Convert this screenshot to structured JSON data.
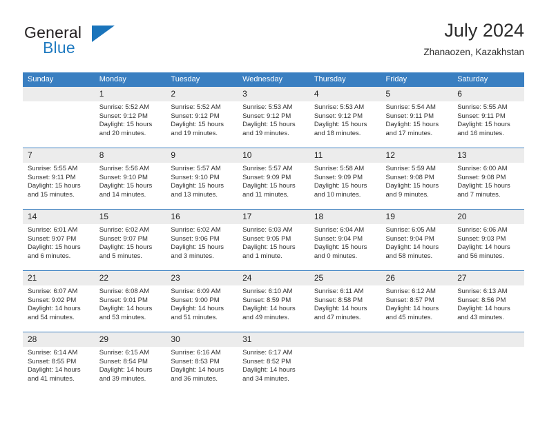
{
  "brand": {
    "name_part1": "General",
    "name_part2": "Blue",
    "triangle_icon": "triangle-icon",
    "accent_color": "#1a74bb"
  },
  "header": {
    "title": "July 2024",
    "location": "Zhanaozen, Kazakhstan"
  },
  "theme": {
    "header_blue": "#3a7fc1",
    "daynum_gray": "#ececec",
    "text": "#303030"
  },
  "calendar": {
    "columns": [
      "Sunday",
      "Monday",
      "Tuesday",
      "Wednesday",
      "Thursday",
      "Friday",
      "Saturday"
    ],
    "weeks": [
      [
        {
          "day": "",
          "empty": true
        },
        {
          "day": "1",
          "sunrise": "Sunrise: 5:52 AM",
          "sunset": "Sunset: 9:12 PM",
          "daylight1": "Daylight: 15 hours",
          "daylight2": "and 20 minutes."
        },
        {
          "day": "2",
          "sunrise": "Sunrise: 5:52 AM",
          "sunset": "Sunset: 9:12 PM",
          "daylight1": "Daylight: 15 hours",
          "daylight2": "and 19 minutes."
        },
        {
          "day": "3",
          "sunrise": "Sunrise: 5:53 AM",
          "sunset": "Sunset: 9:12 PM",
          "daylight1": "Daylight: 15 hours",
          "daylight2": "and 19 minutes."
        },
        {
          "day": "4",
          "sunrise": "Sunrise: 5:53 AM",
          "sunset": "Sunset: 9:12 PM",
          "daylight1": "Daylight: 15 hours",
          "daylight2": "and 18 minutes."
        },
        {
          "day": "5",
          "sunrise": "Sunrise: 5:54 AM",
          "sunset": "Sunset: 9:11 PM",
          "daylight1": "Daylight: 15 hours",
          "daylight2": "and 17 minutes."
        },
        {
          "day": "6",
          "sunrise": "Sunrise: 5:55 AM",
          "sunset": "Sunset: 9:11 PM",
          "daylight1": "Daylight: 15 hours",
          "daylight2": "and 16 minutes."
        }
      ],
      [
        {
          "day": "7",
          "sunrise": "Sunrise: 5:55 AM",
          "sunset": "Sunset: 9:11 PM",
          "daylight1": "Daylight: 15 hours",
          "daylight2": "and 15 minutes."
        },
        {
          "day": "8",
          "sunrise": "Sunrise: 5:56 AM",
          "sunset": "Sunset: 9:10 PM",
          "daylight1": "Daylight: 15 hours",
          "daylight2": "and 14 minutes."
        },
        {
          "day": "9",
          "sunrise": "Sunrise: 5:57 AM",
          "sunset": "Sunset: 9:10 PM",
          "daylight1": "Daylight: 15 hours",
          "daylight2": "and 13 minutes."
        },
        {
          "day": "10",
          "sunrise": "Sunrise: 5:57 AM",
          "sunset": "Sunset: 9:09 PM",
          "daylight1": "Daylight: 15 hours",
          "daylight2": "and 11 minutes."
        },
        {
          "day": "11",
          "sunrise": "Sunrise: 5:58 AM",
          "sunset": "Sunset: 9:09 PM",
          "daylight1": "Daylight: 15 hours",
          "daylight2": "and 10 minutes."
        },
        {
          "day": "12",
          "sunrise": "Sunrise: 5:59 AM",
          "sunset": "Sunset: 9:08 PM",
          "daylight1": "Daylight: 15 hours",
          "daylight2": "and 9 minutes."
        },
        {
          "day": "13",
          "sunrise": "Sunrise: 6:00 AM",
          "sunset": "Sunset: 9:08 PM",
          "daylight1": "Daylight: 15 hours",
          "daylight2": "and 7 minutes."
        }
      ],
      [
        {
          "day": "14",
          "sunrise": "Sunrise: 6:01 AM",
          "sunset": "Sunset: 9:07 PM",
          "daylight1": "Daylight: 15 hours",
          "daylight2": "and 6 minutes."
        },
        {
          "day": "15",
          "sunrise": "Sunrise: 6:02 AM",
          "sunset": "Sunset: 9:07 PM",
          "daylight1": "Daylight: 15 hours",
          "daylight2": "and 5 minutes."
        },
        {
          "day": "16",
          "sunrise": "Sunrise: 6:02 AM",
          "sunset": "Sunset: 9:06 PM",
          "daylight1": "Daylight: 15 hours",
          "daylight2": "and 3 minutes."
        },
        {
          "day": "17",
          "sunrise": "Sunrise: 6:03 AM",
          "sunset": "Sunset: 9:05 PM",
          "daylight1": "Daylight: 15 hours",
          "daylight2": "and 1 minute."
        },
        {
          "day": "18",
          "sunrise": "Sunrise: 6:04 AM",
          "sunset": "Sunset: 9:04 PM",
          "daylight1": "Daylight: 15 hours",
          "daylight2": "and 0 minutes."
        },
        {
          "day": "19",
          "sunrise": "Sunrise: 6:05 AM",
          "sunset": "Sunset: 9:04 PM",
          "daylight1": "Daylight: 14 hours",
          "daylight2": "and 58 minutes."
        },
        {
          "day": "20",
          "sunrise": "Sunrise: 6:06 AM",
          "sunset": "Sunset: 9:03 PM",
          "daylight1": "Daylight: 14 hours",
          "daylight2": "and 56 minutes."
        }
      ],
      [
        {
          "day": "21",
          "sunrise": "Sunrise: 6:07 AM",
          "sunset": "Sunset: 9:02 PM",
          "daylight1": "Daylight: 14 hours",
          "daylight2": "and 54 minutes."
        },
        {
          "day": "22",
          "sunrise": "Sunrise: 6:08 AM",
          "sunset": "Sunset: 9:01 PM",
          "daylight1": "Daylight: 14 hours",
          "daylight2": "and 53 minutes."
        },
        {
          "day": "23",
          "sunrise": "Sunrise: 6:09 AM",
          "sunset": "Sunset: 9:00 PM",
          "daylight1": "Daylight: 14 hours",
          "daylight2": "and 51 minutes."
        },
        {
          "day": "24",
          "sunrise": "Sunrise: 6:10 AM",
          "sunset": "Sunset: 8:59 PM",
          "daylight1": "Daylight: 14 hours",
          "daylight2": "and 49 minutes."
        },
        {
          "day": "25",
          "sunrise": "Sunrise: 6:11 AM",
          "sunset": "Sunset: 8:58 PM",
          "daylight1": "Daylight: 14 hours",
          "daylight2": "and 47 minutes."
        },
        {
          "day": "26",
          "sunrise": "Sunrise: 6:12 AM",
          "sunset": "Sunset: 8:57 PM",
          "daylight1": "Daylight: 14 hours",
          "daylight2": "and 45 minutes."
        },
        {
          "day": "27",
          "sunrise": "Sunrise: 6:13 AM",
          "sunset": "Sunset: 8:56 PM",
          "daylight1": "Daylight: 14 hours",
          "daylight2": "and 43 minutes."
        }
      ],
      [
        {
          "day": "28",
          "sunrise": "Sunrise: 6:14 AM",
          "sunset": "Sunset: 8:55 PM",
          "daylight1": "Daylight: 14 hours",
          "daylight2": "and 41 minutes."
        },
        {
          "day": "29",
          "sunrise": "Sunrise: 6:15 AM",
          "sunset": "Sunset: 8:54 PM",
          "daylight1": "Daylight: 14 hours",
          "daylight2": "and 39 minutes."
        },
        {
          "day": "30",
          "sunrise": "Sunrise: 6:16 AM",
          "sunset": "Sunset: 8:53 PM",
          "daylight1": "Daylight: 14 hours",
          "daylight2": "and 36 minutes."
        },
        {
          "day": "31",
          "sunrise": "Sunrise: 6:17 AM",
          "sunset": "Sunset: 8:52 PM",
          "daylight1": "Daylight: 14 hours",
          "daylight2": "and 34 minutes."
        },
        {
          "day": "",
          "empty": true
        },
        {
          "day": "",
          "empty": true
        },
        {
          "day": "",
          "empty": true
        }
      ]
    ]
  }
}
